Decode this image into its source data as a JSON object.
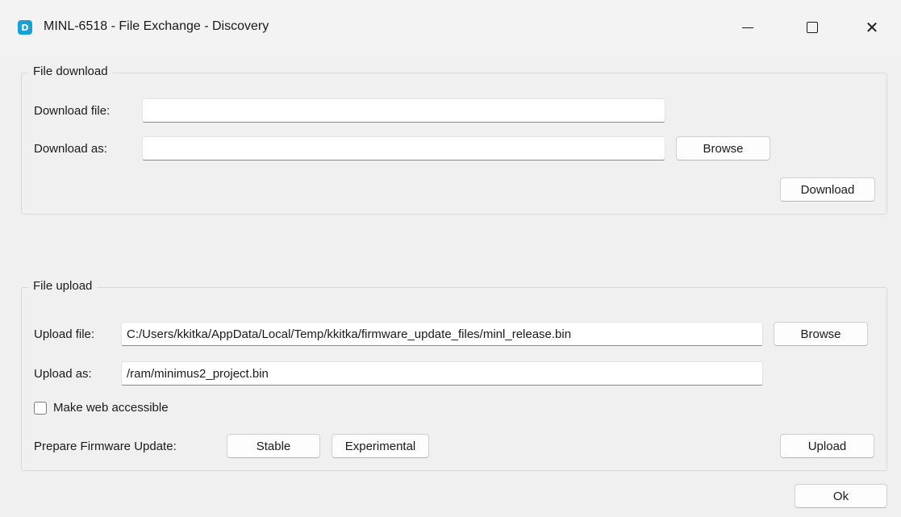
{
  "window": {
    "title": "MINL-6518 - File Exchange - Discovery",
    "app_icon_glyph": "D",
    "minimize_glyph": "",
    "maximize_glyph": "",
    "close_glyph": "✕"
  },
  "download_group": {
    "title": "File download",
    "download_file_label": "Download file:",
    "download_file_value": "",
    "download_as_label": "Download as:",
    "download_as_value": "",
    "browse_label": "Browse",
    "download_label": "Download"
  },
  "upload_group": {
    "title": "File upload",
    "upload_file_label": "Upload file:",
    "upload_file_value": "C:/Users/kkitka/AppData/Local/Temp/kkitka/firmware_update_files/minl_release.bin",
    "upload_as_label": "Upload as:",
    "upload_as_value": "/ram/minimus2_project.bin",
    "browse_label": "Browse",
    "web_accessible_label": "Make web accessible",
    "web_accessible_checked": false,
    "prepare_firmware_label": "Prepare Firmware Update:",
    "stable_label": "Stable",
    "experimental_label": "Experimental",
    "upload_label": "Upload"
  },
  "footer": {
    "ok_label": "Ok"
  },
  "colors": {
    "app_icon": "#1aa0d6",
    "window_background": "#f0f0f0",
    "field_background": "#ffffff"
  },
  "icons": {
    "app": "discovery-app-icon",
    "minimize": "minimize-icon",
    "maximize": "maximize-icon",
    "close": "close-icon"
  }
}
